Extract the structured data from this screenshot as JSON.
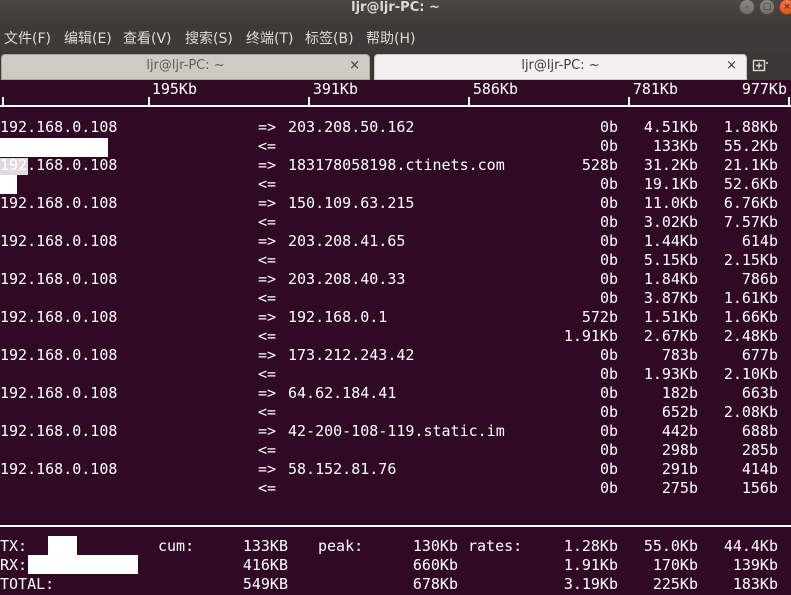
{
  "window": {
    "title": "ljr@ljr-PC: ~"
  },
  "menubar": [
    "文件(F)",
    "编辑(E)",
    "查看(V)",
    "搜索(S)",
    "终端(T)",
    "标签(B)",
    "帮助(H)"
  ],
  "tabs": [
    {
      "title": "ljr@ljr-PC: ~",
      "close": "×"
    },
    {
      "title": "ljr@ljr-PC: ~",
      "close": "×"
    }
  ],
  "new_tab_icon": "new-tab-icon",
  "scale": [
    "195Kb",
    "391Kb",
    "586Kb",
    "781Kb",
    "977Kb"
  ],
  "connections": [
    {
      "host": "192.168.0.108",
      "remote": "203.208.50.162",
      "out": [
        "0b",
        "4.51Kb",
        "1.88Kb"
      ],
      "in": [
        "0b",
        "133Kb",
        "55.2Kb"
      ]
    },
    {
      "host": "192.168.0.108",
      "remote": "183178058198.ctinets.com",
      "out": [
        "528b",
        "31.2Kb",
        "21.1Kb"
      ],
      "in": [
        "0b",
        "19.1Kb",
        "52.6Kb"
      ]
    },
    {
      "host": "192.168.0.108",
      "remote": "150.109.63.215",
      "out": [
        "0b",
        "11.0Kb",
        "6.76Kb"
      ],
      "in": [
        "0b",
        "3.02Kb",
        "7.57Kb"
      ]
    },
    {
      "host": "192.168.0.108",
      "remote": "203.208.41.65",
      "out": [
        "0b",
        "1.44Kb",
        "614b"
      ],
      "in": [
        "0b",
        "5.15Kb",
        "2.15Kb"
      ]
    },
    {
      "host": "192.168.0.108",
      "remote": "203.208.40.33",
      "out": [
        "0b",
        "1.84Kb",
        "786b"
      ],
      "in": [
        "0b",
        "3.87Kb",
        "1.61Kb"
      ]
    },
    {
      "host": "192.168.0.108",
      "remote": "192.168.0.1",
      "out": [
        "572b",
        "1.51Kb",
        "1.66Kb"
      ],
      "in": [
        "1.91Kb",
        "2.67Kb",
        "2.48Kb"
      ]
    },
    {
      "host": "192.168.0.108",
      "remote": "173.212.243.42",
      "out": [
        "0b",
        "783b",
        "677b"
      ],
      "in": [
        "0b",
        "1.93Kb",
        "2.10Kb"
      ]
    },
    {
      "host": "192.168.0.108",
      "remote": "64.62.184.41",
      "out": [
        "0b",
        "182b",
        "663b"
      ],
      "in": [
        "0b",
        "652b",
        "2.08Kb"
      ]
    },
    {
      "host": "192.168.0.108",
      "remote": "42-200-108-119.static.im",
      "out": [
        "0b",
        "442b",
        "688b"
      ],
      "in": [
        "0b",
        "298b",
        "285b"
      ]
    },
    {
      "host": "192.168.0.108",
      "remote": "58.152.81.76",
      "out": [
        "0b",
        "291b",
        "414b"
      ],
      "in": [
        "0b",
        "275b",
        "156b"
      ]
    }
  ],
  "arrows": {
    "out": "=>",
    "in": "<="
  },
  "totals": {
    "labels": {
      "tx": "TX:",
      "rx": "RX:",
      "total": "TOTAL:",
      "cum": "cum:",
      "peak": "peak:",
      "rates": "rates:"
    },
    "tx": {
      "cum": "133KB",
      "peak": "130Kb",
      "rates": [
        "1.28Kb",
        "55.0Kb",
        "44.4Kb"
      ]
    },
    "rx": {
      "cum": "416KB",
      "peak": "660Kb",
      "rates": [
        "1.91Kb",
        "170Kb",
        "139Kb"
      ]
    },
    "total": {
      "cum": "549KB",
      "peak": "678Kb",
      "rates": [
        "3.19Kb",
        "225Kb",
        "183Kb"
      ]
    }
  },
  "colors": {
    "terminal_bg": "#300a24",
    "terminal_fg": "#ffffff",
    "titlebar": "#3c3b37",
    "close_button": "#e95420"
  }
}
